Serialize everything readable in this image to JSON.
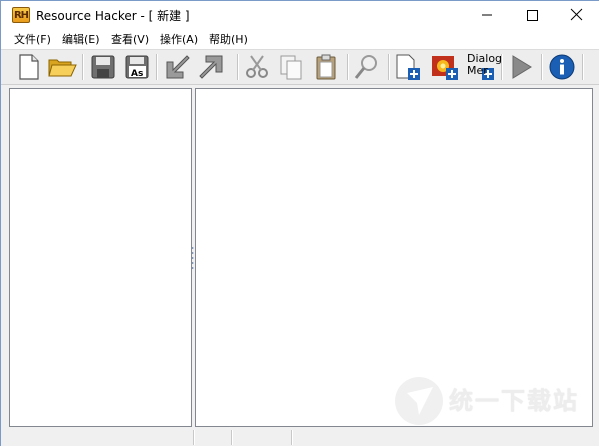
{
  "window": {
    "app_icon_text": "RH",
    "title": "Resource Hacker - [ 新建 ]"
  },
  "menu": {
    "items": [
      {
        "label": "文件(F)"
      },
      {
        "label": "编辑(E)"
      },
      {
        "label": "查看(V)"
      },
      {
        "label": "操作(A)"
      },
      {
        "label": "帮助(H)"
      }
    ]
  },
  "toolbar": {
    "dialog_merge_line1": "Dialog",
    "dialog_merge_line2": "Mer"
  },
  "icons": {
    "new": "new-file-icon",
    "open": "open-folder-icon",
    "save": "save-icon",
    "save_as": "save-as-icon",
    "save_as_text": "As",
    "import": "import-arrow-icon",
    "export": "export-arrow-icon",
    "cut": "scissors-icon",
    "copy": "copy-icon",
    "paste": "paste-icon",
    "find": "magnifier-icon",
    "add_resource": "add-resource-icon",
    "add_image": "add-image-icon",
    "dialog_merge": "dialog-merge-icon",
    "run": "play-icon",
    "about": "info-icon"
  },
  "watermark": {
    "text": "统一下载站"
  },
  "colors": {
    "accent_blue": "#1a5fb4",
    "folder_yellow": "#f2c14e",
    "play_gray": "#8a8a8a"
  }
}
